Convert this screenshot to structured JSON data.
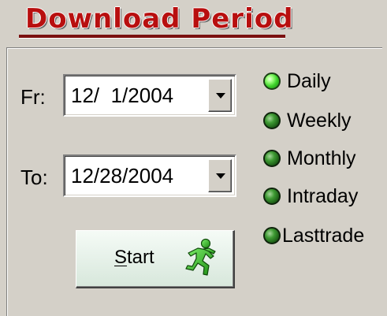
{
  "title": "Download Period",
  "date_range": {
    "from_label": "Fr:",
    "from_value": "12/  1/2004",
    "to_label": "To:",
    "to_value": "12/28/2004"
  },
  "periods": [
    {
      "label": "Daily",
      "selected": true
    },
    {
      "label": "Weekly",
      "selected": false
    },
    {
      "label": "Monthly",
      "selected": false
    },
    {
      "label": "Intraday",
      "selected": false
    },
    {
      "label": "Lasttrade",
      "selected": false
    }
  ],
  "start_button": {
    "mnemonic": "S",
    "rest": "tart",
    "icon": "runner-icon"
  },
  "colors": {
    "title": "#b80f0f",
    "led_on": "#3cd12a",
    "led_off": "#1e6118",
    "window_bg": "#d4d0c8"
  }
}
